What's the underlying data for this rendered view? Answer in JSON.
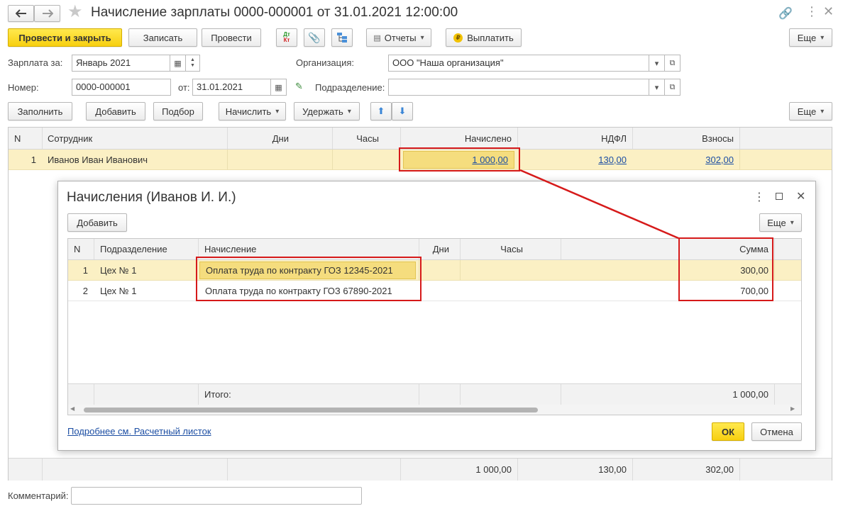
{
  "window": {
    "title": "Начисление зарплаты 0000-000001 от 31.01.2021 12:00:00"
  },
  "toolbar": {
    "post_close": "Провести и закрыть",
    "write": "Записать",
    "post": "Провести",
    "dt_kt": "Дт Кт",
    "reports": "Отчеты",
    "pay": "Выплатить",
    "more": "Еще"
  },
  "form": {
    "salary_for_label": "Зарплата за:",
    "salary_for_value": "Январь 2021",
    "organization_label": "Организация:",
    "organization_value": "ООО \"Наша организация\"",
    "number_label": "Номер:",
    "number_value": "0000-000001",
    "date_label": "от:",
    "date_value": "31.01.2021",
    "department_label": "Подразделение:",
    "department_value": ""
  },
  "table_toolbar": {
    "fill": "Заполнить",
    "add": "Добавить",
    "select": "Подбор",
    "accrue": "Начислить",
    "withhold": "Удержать",
    "more": "Еще"
  },
  "main_table": {
    "headers": {
      "n": "N",
      "employee": "Сотрудник",
      "days": "Дни",
      "hours": "Часы",
      "accrued": "Начислено",
      "ndfl": "НДФЛ",
      "contributions": "Взносы"
    },
    "rows": [
      {
        "n": "1",
        "employee": "Иванов Иван Иванович",
        "days": "",
        "hours": "",
        "accrued": "1 000,00",
        "ndfl": "130,00",
        "contributions": "302,00"
      }
    ],
    "totals": {
      "accrued": "1 000,00",
      "ndfl": "130,00",
      "contributions": "302,00"
    }
  },
  "dialog": {
    "title": "Начисления (Иванов И. И.)",
    "add": "Добавить",
    "more": "Еще",
    "headers": {
      "n": "N",
      "department": "Подразделение",
      "accrual": "Начисление",
      "days": "Дни",
      "hours": "Часы",
      "sum": "Сумма"
    },
    "rows": [
      {
        "n": "1",
        "department": "Цех № 1",
        "accrual": "Оплата труда по контракту ГОЗ 12345-2021",
        "sum": "300,00"
      },
      {
        "n": "2",
        "department": "Цех № 1",
        "accrual": "Оплата труда по контракту ГОЗ 67890-2021",
        "sum": "700,00"
      }
    ],
    "total_label": "Итого:",
    "total_sum": "1 000,00",
    "details_link": "Подробнее см. Расчетный листок",
    "ok": "ОК",
    "cancel": "Отмена"
  },
  "comment": {
    "label": "Комментарий:",
    "value": ""
  },
  "colors": {
    "highlight_row": "#fbf0c4",
    "annotation_red": "#d61a1a",
    "primary_button": "#f7cf10"
  }
}
